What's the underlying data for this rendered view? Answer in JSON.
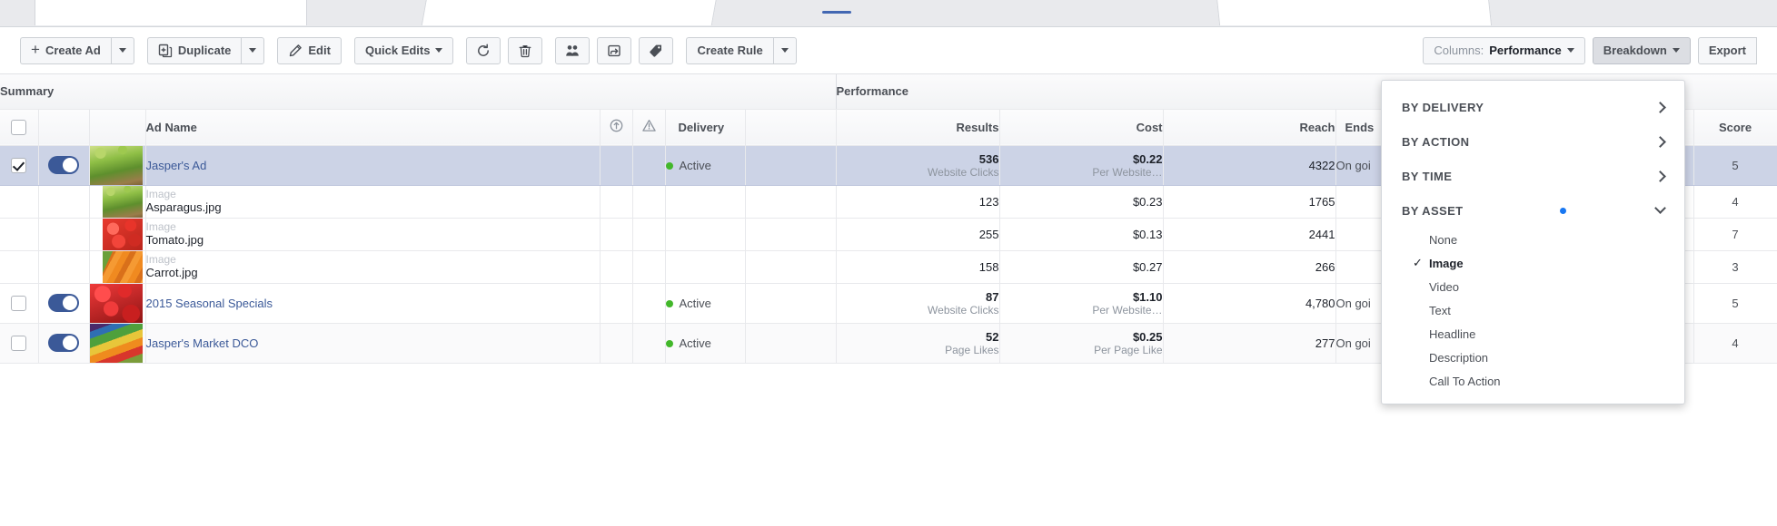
{
  "toolbar": {
    "create_ad": "Create Ad",
    "duplicate": "Duplicate",
    "edit": "Edit",
    "quick_edits": "Quick Edits",
    "create_rule": "Create Rule",
    "columns_prefix": "Columns:",
    "columns_value": "Performance",
    "breakdown": "Breakdown",
    "export": "Export",
    "icons": {
      "plus": "plus-icon",
      "duplicate": "duplicate-icon",
      "pencil": "pencil-icon",
      "refresh": "refresh-icon",
      "trash": "trash-icon",
      "audience": "audience-icon",
      "share": "share-icon",
      "tag": "tag-icon"
    }
  },
  "table": {
    "groups": [
      {
        "label": "Summary"
      },
      {
        "label": "Performance"
      }
    ],
    "columns": {
      "ad_name": "Ad Name",
      "delivery": "Delivery",
      "results": "Results",
      "cost": "Cost",
      "reach": "Reach",
      "ends": "Ends",
      "score": "Score"
    },
    "rows": [
      {
        "type": "parent",
        "selected": true,
        "checked": true,
        "toggle_on": true,
        "thumb": "asparagus-thumb",
        "name": "Jasper's Ad",
        "delivery": "Active",
        "results": "536",
        "results_sub": "Website Clicks",
        "cost": "$0.22",
        "cost_sub": "Per Website…",
        "reach": "4322",
        "ends": "On goi",
        "score": "5"
      },
      {
        "type": "asset",
        "asset_label": "Image",
        "thumb": "asparagus-thumb",
        "name": "Asparagus.jpg",
        "results": "123",
        "cost": "$0.23",
        "reach": "1765",
        "ends": "",
        "score": "4"
      },
      {
        "type": "asset",
        "asset_label": "Image",
        "thumb": "tomato-thumb",
        "name": "Tomato.jpg",
        "results": "255",
        "cost": "$0.13",
        "reach": "2441",
        "ends": "",
        "score": "7"
      },
      {
        "type": "asset",
        "asset_label": "Image",
        "thumb": "carrot-thumb",
        "name": "Carrot.jpg",
        "results": "158",
        "cost": "$0.27",
        "reach": "266",
        "ends": "",
        "score": "3"
      },
      {
        "type": "parent",
        "selected": false,
        "checked": false,
        "toggle_on": true,
        "thumb": "berry-thumb",
        "name": "2015 Seasonal Specials",
        "delivery": "Active",
        "results": "87",
        "results_sub": "Website Clicks",
        "cost": "$1.10",
        "cost_sub": "Per Website…",
        "reach": "4,780",
        "ends": "On goi",
        "score": "5"
      },
      {
        "type": "parent",
        "selected": false,
        "checked": false,
        "toggle_on": true,
        "thumb": "mixed-produce-thumb",
        "name": "Jasper's Market DCO",
        "delivery": "Active",
        "results": "52",
        "results_sub": "Page Likes",
        "cost": "$0.25",
        "cost_sub": "Per Page Like",
        "reach": "277",
        "ends": "On goi",
        "score": "4"
      }
    ]
  },
  "breakdown_menu": {
    "groups": [
      {
        "label": "BY DELIVERY",
        "state": "collapsed",
        "has_dot": false
      },
      {
        "label": "BY ACTION",
        "state": "collapsed",
        "has_dot": false
      },
      {
        "label": "BY TIME",
        "state": "collapsed",
        "has_dot": false
      },
      {
        "label": "BY ASSET",
        "state": "expanded",
        "has_dot": true
      }
    ],
    "asset_options": [
      {
        "label": "None",
        "checked": false
      },
      {
        "label": "Image",
        "checked": true
      },
      {
        "label": "Video",
        "checked": false
      },
      {
        "label": "Text",
        "checked": false
      },
      {
        "label": "Headline",
        "checked": false
      },
      {
        "label": "Description",
        "checked": false
      },
      {
        "label": "Call To Action",
        "checked": false
      }
    ]
  },
  "colors": {
    "link": "#3b5998",
    "active_dot": "#42b72a",
    "toggle_on": "#3b5998",
    "selected_row": "#ccd3e6",
    "blue_dot": "#1877f2"
  }
}
